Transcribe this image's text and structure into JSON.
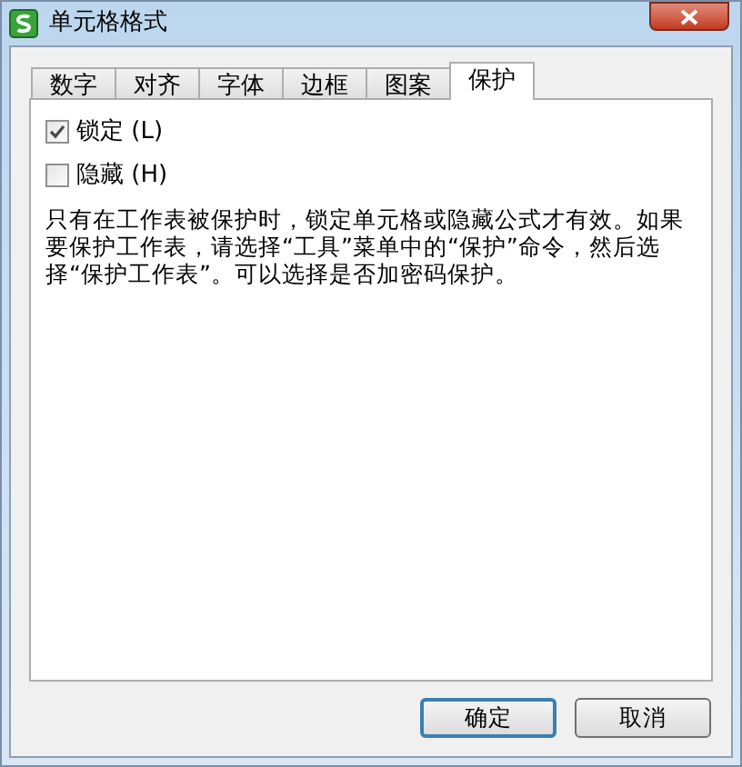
{
  "window": {
    "title": "单元格格式"
  },
  "tabs": [
    {
      "label": "数字",
      "selected": false
    },
    {
      "label": "对齐",
      "selected": false
    },
    {
      "label": "字体",
      "selected": false
    },
    {
      "label": "边框",
      "selected": false
    },
    {
      "label": "图案",
      "selected": false
    },
    {
      "label": "保护",
      "selected": true
    }
  ],
  "checkboxes": [
    {
      "label": "锁定",
      "shortcut": "(L)",
      "checked": true
    },
    {
      "label": "隐藏",
      "shortcut": "(H)",
      "checked": false
    }
  ],
  "description": "只有在工作表被保护时，锁定单元格或隐藏公式才有效。如果要保护工作表，请选择“工具”菜单中的“保护”命令，然后选择“保护工作表”。可以选择是否加密码保护。",
  "buttons": [
    {
      "label": "确定",
      "default": true
    },
    {
      "label": "取消",
      "default": false
    }
  ]
}
